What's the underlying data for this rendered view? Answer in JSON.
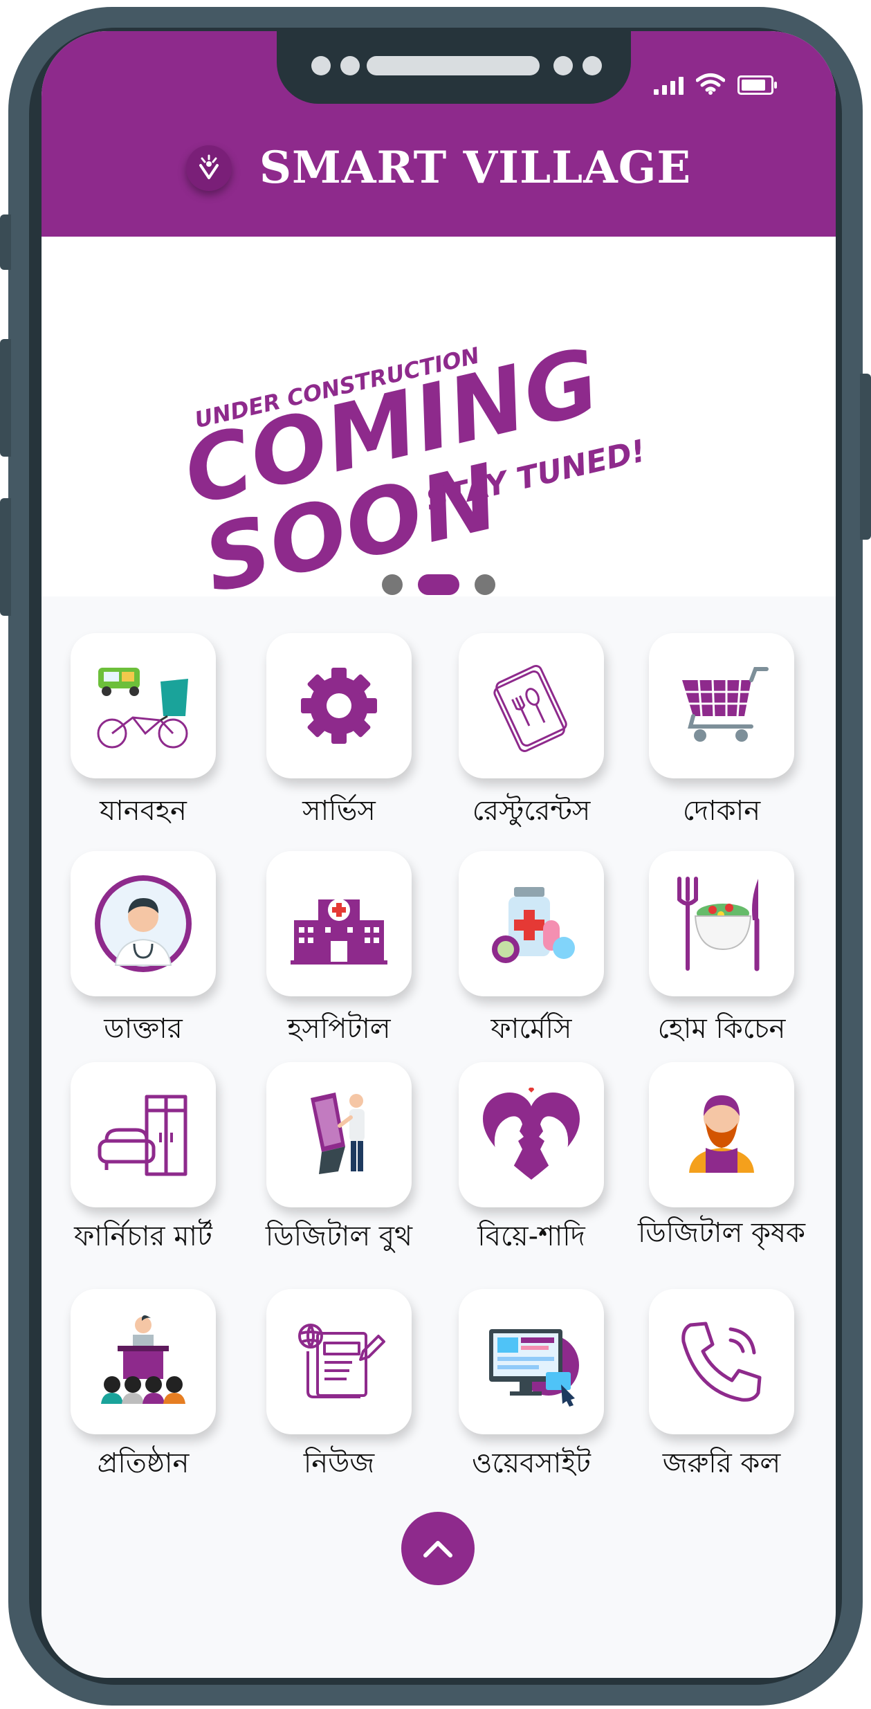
{
  "app": {
    "title": "SMART VILLAGE"
  },
  "banner": {
    "line1": "UNDER CONSTRUCTION",
    "line2": "COMING SOON",
    "line3": "STAY TUNED!"
  },
  "pager": {
    "count": 3,
    "active_index": 1
  },
  "services": [
    {
      "label": "যানবহন",
      "icon": "rickshaw-icon"
    },
    {
      "label": "সার্ভিস",
      "icon": "gear-icon"
    },
    {
      "label": "রেস্টুরেন্টস",
      "icon": "menu-book-icon"
    },
    {
      "label": "দোকান",
      "icon": "shopping-cart-icon"
    },
    {
      "label": "ডাক্তার",
      "icon": "doctor-icon"
    },
    {
      "label": "হসপিটাল",
      "icon": "hospital-icon"
    },
    {
      "label": "ফার্মেসি",
      "icon": "pharmacy-icon"
    },
    {
      "label": "হোম কিচেন",
      "icon": "salad-bowl-icon"
    },
    {
      "label": "ফার্নিচার মার্ট",
      "icon": "furniture-icon"
    },
    {
      "label": "ডিজিটাল বুথ",
      "icon": "digital-booth-icon"
    },
    {
      "label": "বিয়ে-শাদি",
      "icon": "wedding-heart-icon"
    },
    {
      "label": "ডিজিটাল কৃষক",
      "icon": "farmer-icon"
    },
    {
      "label": "প্রতিষ্ঠান",
      "icon": "institution-icon"
    },
    {
      "label": "নিউজ",
      "icon": "newspaper-icon"
    },
    {
      "label": "ওয়েবসাইট",
      "icon": "website-icon"
    },
    {
      "label": "জরুরি কল",
      "icon": "phone-call-icon"
    }
  ],
  "colors": {
    "brand": "#8e2a8c",
    "frame": "#455964"
  }
}
